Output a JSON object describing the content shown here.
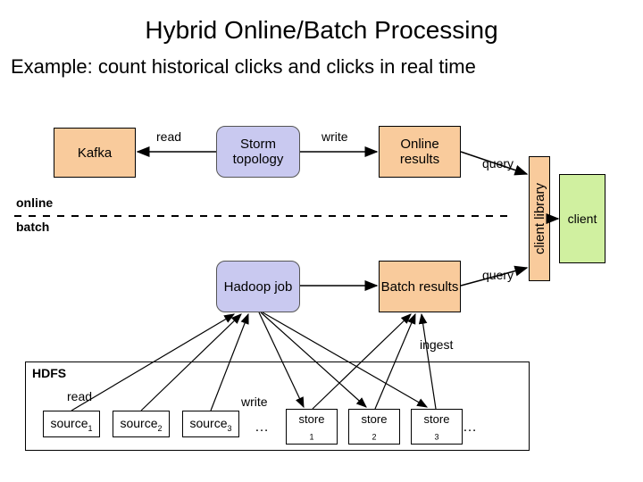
{
  "title": "Hybrid Online/Batch Processing",
  "subtitle": "Example: count historical clicks and clicks in real time",
  "nodes": {
    "kafka": "Kafka",
    "storm": "Storm topology",
    "online_results": "Online results",
    "hadoop": "Hadoop job",
    "batch_results": "Batch results",
    "client_library": "client library",
    "client": "client"
  },
  "labels": {
    "read": "read",
    "write": "write",
    "query": "query",
    "online": "online",
    "batch": "batch",
    "ingest": "ingest",
    "hdfs": "HDFS",
    "ellipsis": "…"
  },
  "sources": {
    "s1": "source",
    "s1n": "1",
    "s2": "source",
    "s2n": "2",
    "s3": "source",
    "s3n": "3"
  },
  "stores": {
    "t1": "store",
    "t1n": "1",
    "t2": "store",
    "t2n": "2",
    "t3": "store",
    "t3n": "3"
  }
}
